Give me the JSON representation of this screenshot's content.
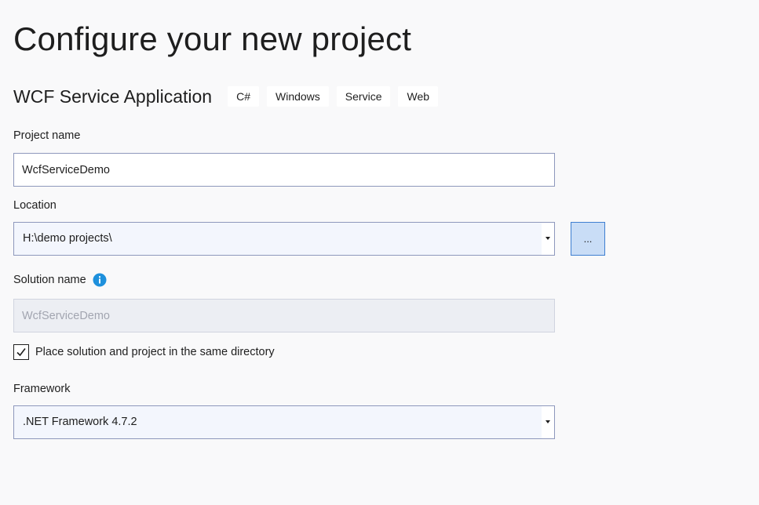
{
  "page": {
    "title": "Configure your new project"
  },
  "template": {
    "name": "WCF Service Application",
    "tags": [
      "C#",
      "Windows",
      "Service",
      "Web"
    ]
  },
  "project_name": {
    "label": "Project name",
    "value": "WcfServiceDemo"
  },
  "location": {
    "label": "Location",
    "value": "H:\\demo projects\\",
    "browse_label": "..."
  },
  "solution_name": {
    "label": "Solution name",
    "value": "WcfServiceDemo",
    "info_icon": "info-icon"
  },
  "same_directory": {
    "label": "Place solution and project in the same directory",
    "checked": true
  },
  "framework": {
    "label": "Framework",
    "value": ".NET Framework 4.7.2"
  },
  "colors": {
    "background": "#f9f9fa",
    "accent": "#1e90dc",
    "input_border": "#8e98bc",
    "browse_bg": "#c9ddf6",
    "browse_border": "#3f7fd1"
  }
}
